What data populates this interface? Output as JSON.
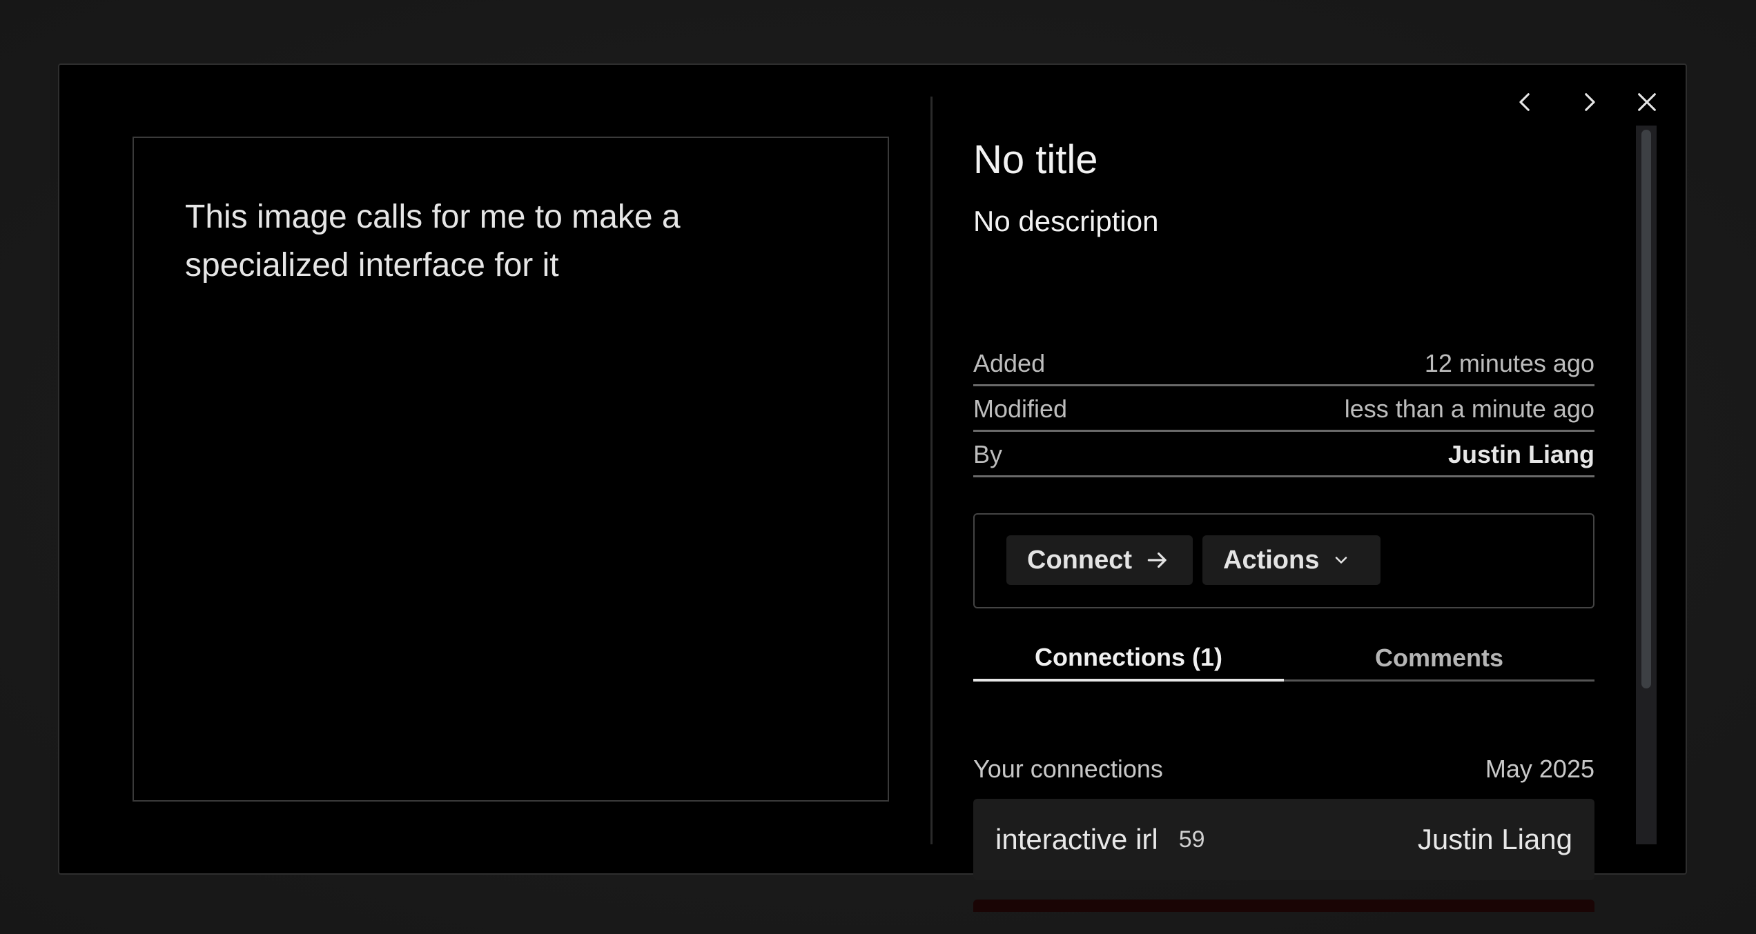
{
  "preview": {
    "text": "This image calls for me to make a specialized interface for it"
  },
  "header_controls": {
    "prev_icon": "chevron-left-icon",
    "next_icon": "chevron-right-icon",
    "close_icon": "close-icon"
  },
  "block": {
    "title": "No title",
    "description": "No description",
    "meta": [
      {
        "label": "Added",
        "value": "12 minutes ago"
      },
      {
        "label": "Modified",
        "value": "less than a minute ago"
      },
      {
        "label": "By",
        "value": "Justin Liang"
      }
    ]
  },
  "actions": {
    "connect_label": "Connect",
    "connect_icon": "arrow-right-icon",
    "actions_label": "Actions",
    "actions_icon": "chevron-down-icon"
  },
  "tabs": [
    {
      "label": "Connections (1)",
      "active": true
    },
    {
      "label": "Comments",
      "active": false
    }
  ],
  "connections": {
    "heading": "Your connections",
    "date": "May 2025",
    "items": [
      {
        "name": "interactive irl",
        "count": "59",
        "owner": "Justin Liang"
      }
    ]
  },
  "colors": {
    "background": "#000000",
    "backdrop": "#1b1b1b",
    "pill": "#1c1c1c",
    "text": "#f2f2f2",
    "muted": "#bdbdbd"
  }
}
